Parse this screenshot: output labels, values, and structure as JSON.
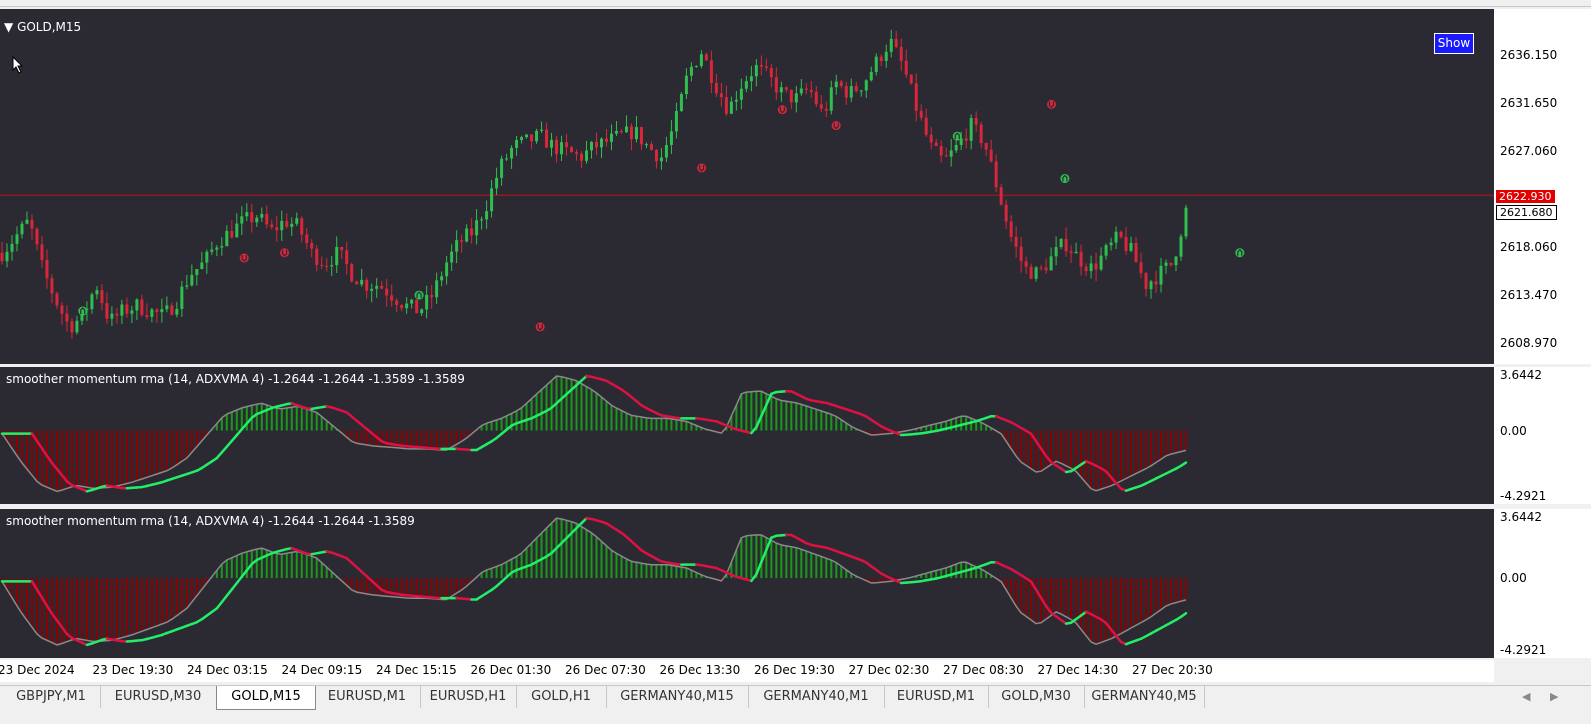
{
  "chart_title": "GOLD,M15",
  "show_button": "Show",
  "price_axis": {
    "ticks": [
      "2636.150",
      "2631.650",
      "2627.060",
      "2618.060",
      "2613.470",
      "2608.970"
    ],
    "bid_label": "2622.930",
    "last_label": "2621.680"
  },
  "indicator1": {
    "title": "smoother momentum rma (14, ADXVMA 4) -1.2644 -1.2644 -1.3589 -1.3589",
    "ticks": [
      "3.6442",
      "0.00",
      "-4.2921"
    ]
  },
  "indicator2": {
    "title": "smoother momentum rma (14, ADXVMA 4) -1.2644 -1.2644 -1.3589",
    "ticks": [
      "3.6442",
      "0.00",
      "-4.2921"
    ]
  },
  "time_axis": [
    "23 Dec 2024",
    "23 Dec 19:30",
    "24 Dec 03:15",
    "24 Dec 09:15",
    "24 Dec 15:15",
    "26 Dec 01:30",
    "26 Dec 07:30",
    "26 Dec 13:30",
    "26 Dec 19:30",
    "27 Dec 02:30",
    "27 Dec 08:30",
    "27 Dec 14:30",
    "27 Dec 20:30"
  ],
  "tabs": [
    {
      "label": "GBPJPY,M1"
    },
    {
      "label": "EURUSD,M30"
    },
    {
      "label": "GOLD,M15",
      "active": true
    },
    {
      "label": "EURUSD,M1"
    },
    {
      "label": "EURUSD,H1"
    },
    {
      "label": "GOLD,H1"
    },
    {
      "label": "GERMANY40,M15"
    },
    {
      "label": "GERMANY40,M1"
    },
    {
      "label": "EURUSD,M1"
    },
    {
      "label": "GOLD,M30"
    },
    {
      "label": "GERMANY40,M5"
    }
  ],
  "colors": {
    "background": "#2b2a33",
    "bull": "#2fbf4f",
    "bear": "#d9263a",
    "hline": "#c0101a",
    "mom_up": "#22ee66",
    "mom_down": "#dd1144",
    "hist_up": "#1a9a1a",
    "hist_down": "#8b0000"
  },
  "chart_data": [
    {
      "type": "candlestick",
      "symbol": "GOLD",
      "timeframe": "M15",
      "ylim": [
        2607.0,
        2640.5
      ],
      "x_ticks": [
        "23 Dec 2024",
        "23 Dec 19:30",
        "24 Dec 03:15",
        "24 Dec 09:15",
        "24 Dec 15:15",
        "26 Dec 01:30",
        "26 Dec 07:30",
        "26 Dec 13:30",
        "26 Dec 19:30",
        "27 Dec 02:30",
        "27 Dec 08:30",
        "27 Dec 14:30",
        "27 Dec 20:30"
      ],
      "close_path": [
        2617.5,
        2619.0,
        2620.5,
        2616.0,
        2613.0,
        2610.5,
        2611.5,
        2614.5,
        2611.0,
        2612.0,
        2612.5,
        2612.0,
        2611.5,
        2613.0,
        2615.5,
        2616.5,
        2618.5,
        2619.5,
        2620.5,
        2621.0,
        2619.5,
        2620.5,
        2620.0,
        2617.5,
        2616.5,
        2617.5,
        2615.5,
        2614.5,
        2614.5,
        2613.5,
        2612.5,
        2612.0,
        2613.5,
        2616.5,
        2618.5,
        2619.5,
        2622.0,
        2625.5,
        2627.5,
        2628.0,
        2628.5,
        2627.5,
        2627.0,
        2626.5,
        2627.5,
        2628.0,
        2628.5,
        2629.0,
        2627.5,
        2626.5,
        2629.5,
        2634.5,
        2636.5,
        2633.5,
        2631.0,
        2633.5,
        2635.0,
        2634.0,
        2632.5,
        2632.0,
        2633.0,
        2630.5,
        2633.5,
        2632.5,
        2633.5,
        2635.5,
        2637.5,
        2635.0,
        2631.0,
        2627.5,
        2626.0,
        2627.5,
        2629.5,
        2628.0,
        2623.5,
        2619.0,
        2616.0,
        2615.5,
        2617.0,
        2618.5,
        2617.0,
        2616.0,
        2617.5,
        2619.0,
        2617.5,
        2614.5,
        2615.5,
        2616.5,
        2621.5
      ],
      "horizontal_line": 2622.93,
      "bid": 2622.93,
      "last": 2621.68,
      "fractals_up": [
        [
          6,
          2612.0
        ],
        [
          31,
          2613.5
        ],
        [
          71,
          2628.5
        ],
        [
          79,
          2624.5
        ],
        [
          92,
          2617.5
        ]
      ],
      "fractals_down": [
        [
          18,
          2617.0
        ],
        [
          21,
          2617.5
        ],
        [
          40,
          2610.5
        ],
        [
          52,
          2625.5
        ],
        [
          58,
          2631.0
        ],
        [
          62,
          2629.5
        ],
        [
          78,
          2631.5
        ]
      ]
    },
    {
      "type": "line+histogram",
      "title": "smoother momentum rma (14, ADXVMA 4) -1.2644 -1.2644 -1.3589 -1.3589",
      "ylim": [
        -4.2921,
        3.6442
      ],
      "values": [
        -0.2,
        -2.0,
        -3.5,
        -4.0,
        -3.6,
        -3.8,
        -3.7,
        -3.4,
        -3.0,
        -2.6,
        -1.8,
        -0.4,
        1.0,
        1.5,
        1.8,
        1.4,
        1.6,
        1.2,
        0.2,
        -0.8,
        -1.0,
        -1.1,
        -1.2,
        -1.2,
        -1.3,
        -0.6,
        0.4,
        0.8,
        1.4,
        2.5,
        3.6,
        3.3,
        2.6,
        1.6,
        1.0,
        0.8,
        0.8,
        0.6,
        0.1,
        -0.2,
        2.5,
        2.6,
        2.0,
        1.8,
        1.4,
        1.0,
        0.2,
        -0.3,
        -0.2,
        0.0,
        0.3,
        0.6,
        1.0,
        0.5,
        -0.2,
        -2.0,
        -2.8,
        -2.0,
        -2.6,
        -4.0,
        -3.6,
        -3.0,
        -2.4,
        -1.6,
        -1.3
      ]
    },
    {
      "type": "line+histogram",
      "title": "smoother momentum rma (14, ADXVMA 4) -1.2644 -1.2644 -1.3589",
      "ylim": [
        -4.2921,
        3.6442
      ],
      "values": [
        -0.2,
        -2.0,
        -3.5,
        -4.0,
        -3.6,
        -3.8,
        -3.7,
        -3.4,
        -3.0,
        -2.6,
        -1.8,
        -0.4,
        1.0,
        1.5,
        1.8,
        1.4,
        1.6,
        1.2,
        0.2,
        -0.8,
        -1.0,
        -1.1,
        -1.2,
        -1.2,
        -1.3,
        -0.6,
        0.4,
        0.8,
        1.4,
        2.5,
        3.6,
        3.3,
        2.6,
        1.6,
        1.0,
        0.8,
        0.8,
        0.6,
        0.1,
        -0.2,
        2.5,
        2.6,
        2.0,
        1.8,
        1.4,
        1.0,
        0.2,
        -0.3,
        -0.2,
        0.0,
        0.3,
        0.6,
        1.0,
        0.5,
        -0.2,
        -2.0,
        -2.8,
        -2.0,
        -2.6,
        -4.0,
        -3.6,
        -3.0,
        -2.4,
        -1.6,
        -1.3
      ]
    }
  ]
}
